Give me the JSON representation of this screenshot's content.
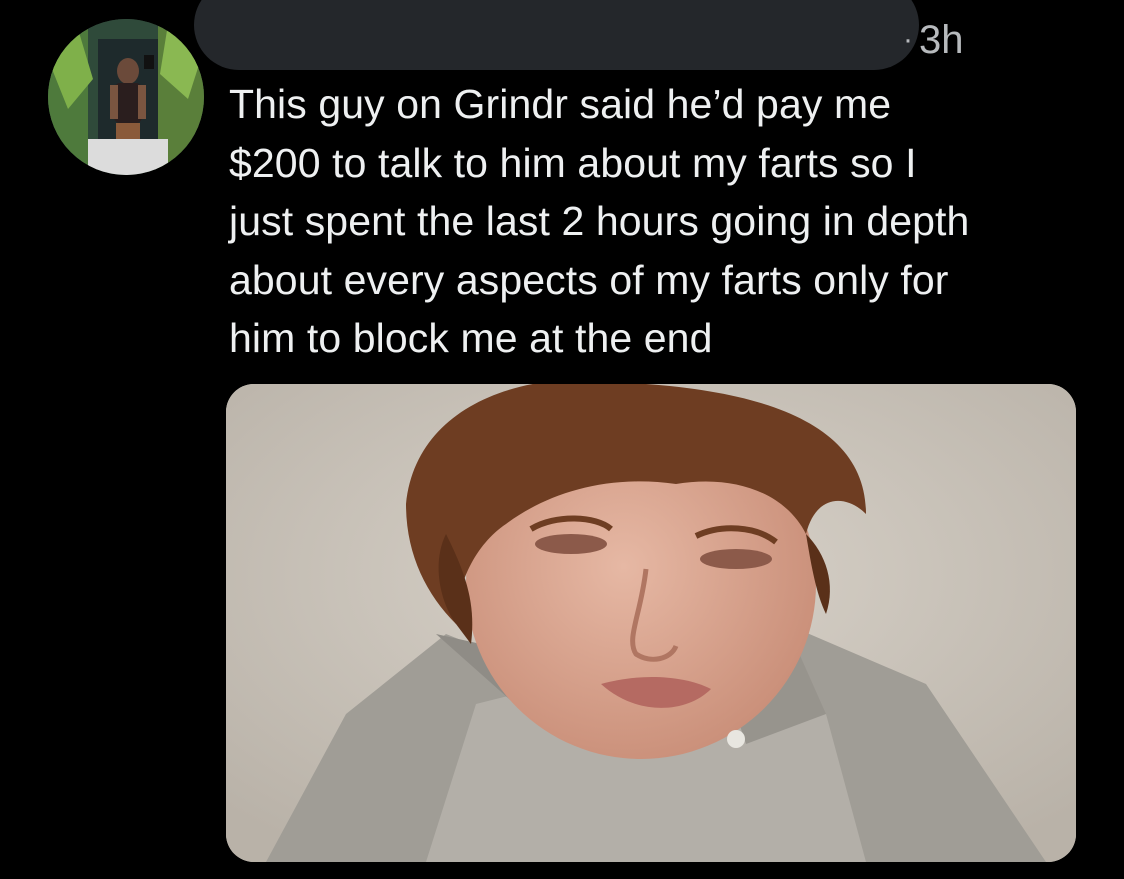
{
  "tweet": {
    "timestamp": "3h",
    "timestamp_separator": "·",
    "text": "This guy on Grindr said he’d pay me\n$200 to talk to him about my farts so I\njust spent the last 2 hours going in depth\nabout every aspects of my farts only for\nhim to block me at the end"
  },
  "colors": {
    "background": "#000000",
    "text": "#eef0f1",
    "secondary_text": "#b7babd",
    "redaction": "#24272b"
  },
  "icons": {
    "avatar": "profile-photo",
    "media": "attached-photo"
  }
}
